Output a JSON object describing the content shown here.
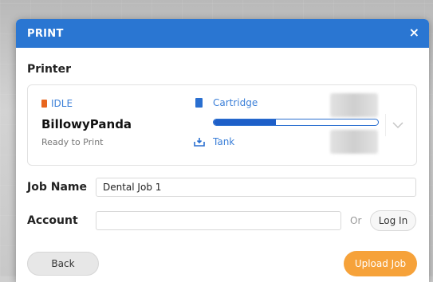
{
  "dialog": {
    "title": "PRINT",
    "close_symbol": "×"
  },
  "printer": {
    "section_label": "Printer",
    "status": "IDLE",
    "status_icon": "printer-status-icon",
    "name": "BillowyPanda",
    "substatus": "Ready to Print",
    "cartridge_label": "Cartridge",
    "cartridge_icon": "cartridge-icon",
    "cartridge_level": 0.38,
    "tank_label": "Tank",
    "tank_icon": "tank-icon",
    "dropdown_icon": "chevron-down-icon"
  },
  "job": {
    "label": "Job Name",
    "value": "Dental Job 1"
  },
  "account": {
    "label": "Account",
    "value": "",
    "or_text": "Or",
    "login_label": "Log In"
  },
  "footer": {
    "back_label": "Back",
    "upload_label": "Upload Job"
  },
  "colors": {
    "header": "#2a76d2",
    "status_accent": "#e8661e",
    "link_blue": "#3b7fd8",
    "upload_button": "#f6a23a"
  }
}
